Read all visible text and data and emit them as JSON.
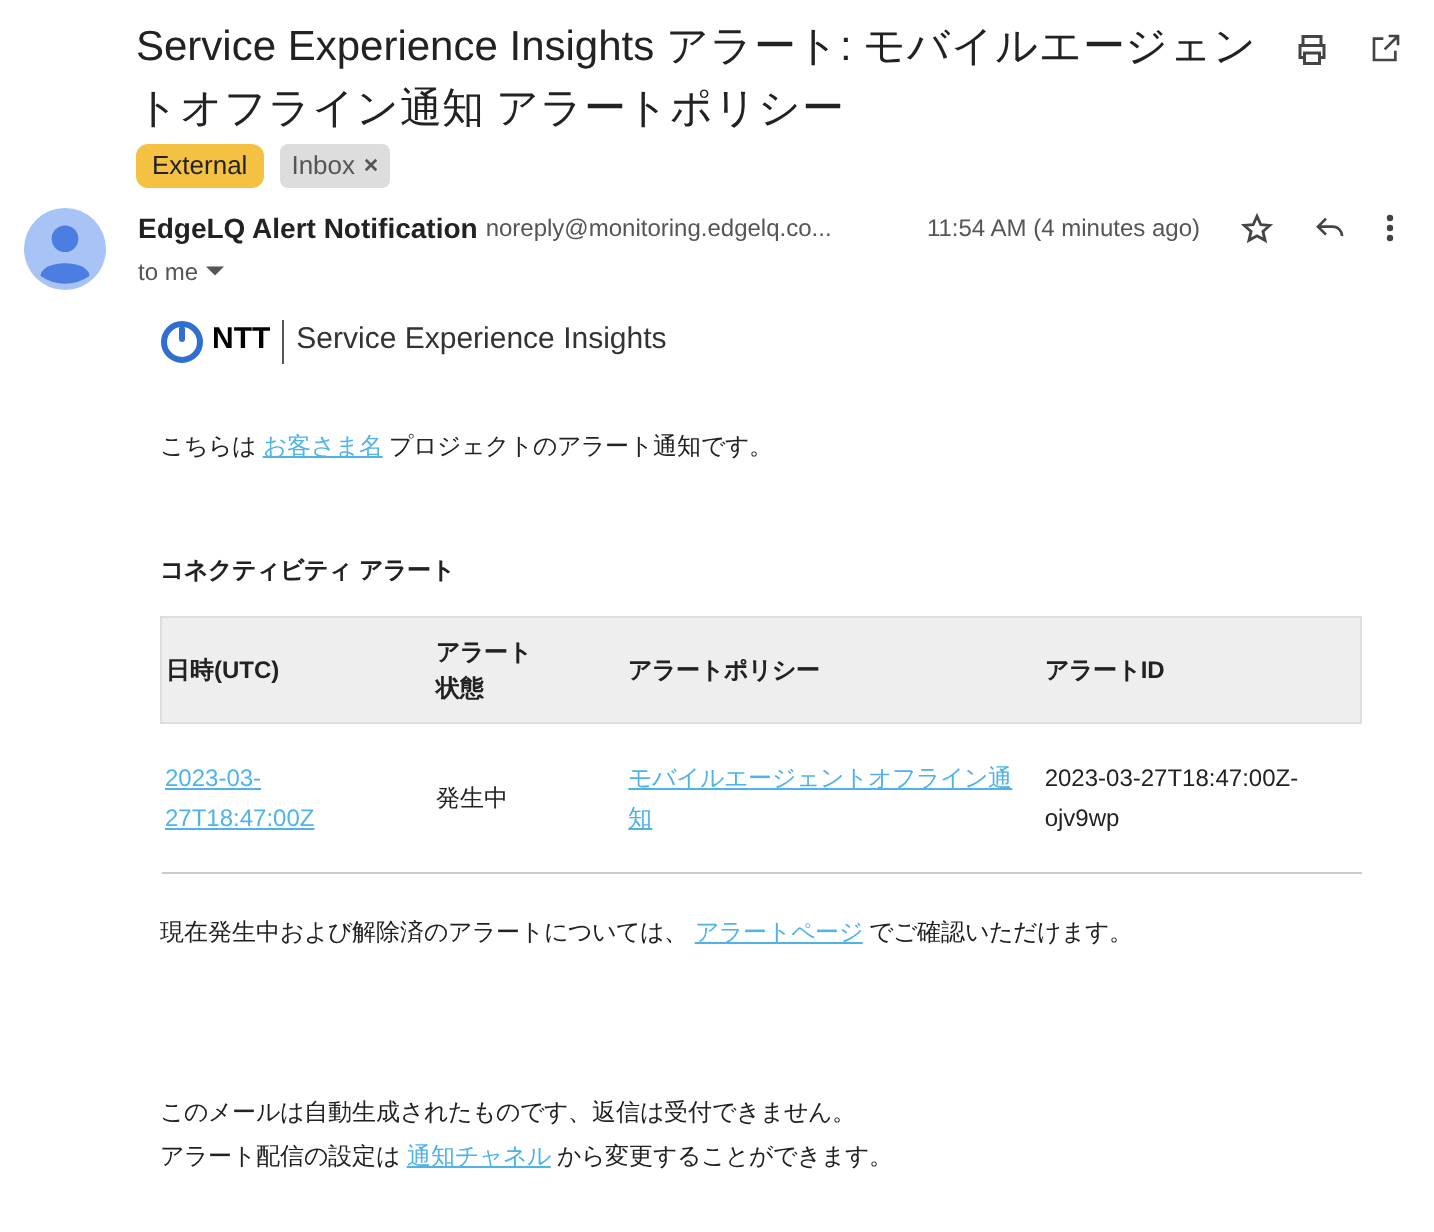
{
  "subject": "Service Experience Insights アラート: モバイルエージェントオフライン通知 アラートポリシー",
  "labels": [
    {
      "text": "External",
      "kind": "external"
    },
    {
      "text": "Inbox",
      "kind": "removable"
    }
  ],
  "sender": {
    "name": "EdgeLQ Alert Notification",
    "email": "noreply@monitoring.edgelq.co...",
    "time": "11:54 AM (4 minutes ago)",
    "recipient": "to me"
  },
  "body": {
    "logo_brand": "NTT",
    "logo_product": "Service Experience Insights",
    "intro": {
      "before": "こちらは ",
      "link": "お客さま名",
      "after": " プロジェクトのアラート通知です。"
    },
    "section_title": "コネクティビティ アラート",
    "table": {
      "columns": [
        "日時(UTC)",
        "アラート状態",
        "アラートポリシー",
        "アラートID"
      ],
      "rows": [
        [
          {
            "text": "2023-03-27T18:47:00Z",
            "kind": "link"
          },
          {
            "text": "発生中",
            "kind": "text"
          },
          {
            "text": "モバイルエージェントオフライン通知",
            "kind": "link"
          },
          {
            "text": "2023-03-27T18:47:00Z-ojv9wp",
            "kind": "text"
          }
        ]
      ]
    },
    "note": {
      "before": "現在発生中および解除済のアラートについては、 ",
      "link": "アラートページ",
      "after": " でご確認いただけます。"
    },
    "footer_line": "このメールは自動生成されたものです、返信は受付できません。",
    "footer_settings": {
      "before": "アラート配信の設定は ",
      "link": "通知チャネル",
      "after": " から変更することができます。"
    }
  }
}
